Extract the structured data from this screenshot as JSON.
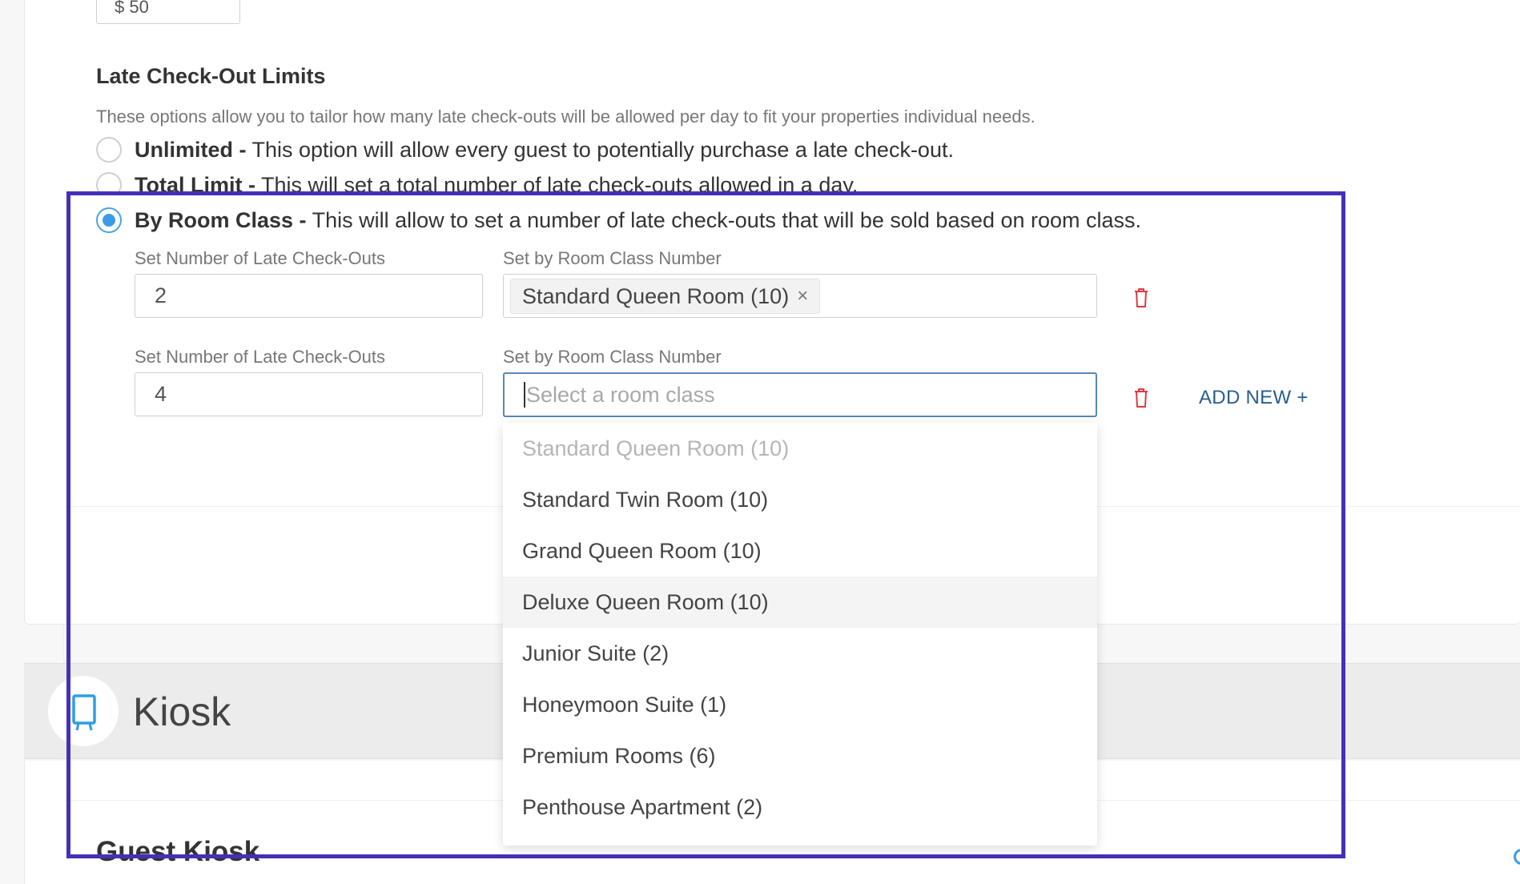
{
  "price_field": {
    "value": "$ 50"
  },
  "late_checkout": {
    "title": "Late Check-Out Limits",
    "description": "These options allow you to tailor how many late check-outs will be allowed per day to fit your properties individual needs.",
    "options": [
      {
        "name": "Unlimited -",
        "text": " This option will allow every guest to potentially purchase a late check-out.",
        "checked": false
      },
      {
        "name": "Total Limit -",
        "text": " This will set a total number of late check-outs allowed in a day.",
        "checked": false
      },
      {
        "name": "By Room Class -",
        "text": " This will allow to set a number of late check-outs that will be sold based on room class.",
        "checked": true
      }
    ],
    "rows": [
      {
        "count_label": "Set Number of Late Check-Outs",
        "count_value": "2",
        "class_label": "Set by Room Class Number",
        "selected_tag": "Standard Queen Room (10)",
        "tag_remove": "×"
      },
      {
        "count_label": "Set Number of Late Check-Outs",
        "count_value": "4",
        "class_label": "Set by Room Class Number",
        "class_placeholder": "Select a room class"
      }
    ],
    "add_new_label": "ADD NEW +"
  },
  "dropdown": {
    "options": [
      {
        "label": "Standard Queen Room (10)",
        "state": "disabled"
      },
      {
        "label": "Standard Twin Room (10)",
        "state": "normal"
      },
      {
        "label": "Grand Queen Room (10)",
        "state": "normal"
      },
      {
        "label": "Deluxe Queen Room (10)",
        "state": "hover"
      },
      {
        "label": "Junior Suite (2)",
        "state": "normal"
      },
      {
        "label": "Honeymoon Suite (1)",
        "state": "normal"
      },
      {
        "label": "Premium Rooms (6)",
        "state": "normal"
      },
      {
        "label": "Penthouse Apartment (2)",
        "state": "normal"
      }
    ]
  },
  "kiosk": {
    "icon": "kiosk-icon",
    "title": "Kiosk",
    "subsection_title": "Guest Kiosk"
  },
  "colors": {
    "accent_blue": "#3b9be4",
    "link_blue": "#2a5d8f",
    "delete_red": "#e0393e",
    "highlight_purple": "#4430b8"
  }
}
